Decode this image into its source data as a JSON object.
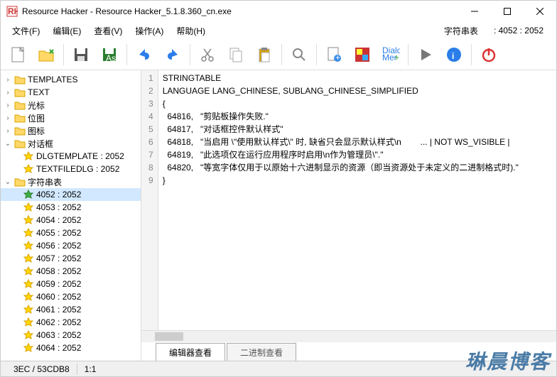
{
  "window": {
    "title": "Resource Hacker - Resource Hacker_5.1.8.360_cn.exe"
  },
  "menu": {
    "file": "文件(F)",
    "edit": "编辑(E)",
    "view": "查看(V)",
    "action": "操作(A)",
    "help": "帮助(H)",
    "charset_label": "字符串表",
    "charset_value": ": 4052 : 2052"
  },
  "tree": {
    "templates": "TEMPLATES",
    "text": "TEXT",
    "cursor": "光标",
    "bitmap": "位图",
    "icon": "图标",
    "dialog": "对话框",
    "dlg1": "DLGTEMPLATE : 2052",
    "dlg2": "TEXTFILEDLG : 2052",
    "strtable": "字符串表",
    "items": [
      "4052 : 2052",
      "4053 : 2052",
      "4054 : 2052",
      "4055 : 2052",
      "4056 : 2052",
      "4057 : 2052",
      "4058 : 2052",
      "4059 : 2052",
      "4060 : 2052",
      "4061 : 2052",
      "4062 : 2052",
      "4063 : 2052",
      "4064 : 2052"
    ]
  },
  "code": {
    "lines": [
      "STRINGTABLE",
      "LANGUAGE LANG_CHINESE, SUBLANG_CHINESE_SIMPLIFIED",
      "{",
      "  64816, \t\"剪贴板操作失败.\"",
      "  64817, \t\"对话框控件默认样式\"",
      "  64818, \t\"当启用 \\\"使用默认样式\\\" 时, 缺省只会显示默认样式\\n        ... | NOT WS_VISIBLE | ",
      "  64819, \t\"此选项仅在运行应用程序时启用\\n作为管理员\\\".\"",
      "  64820, \t\"等宽字体仅用于以原始十六进制显示的资源（即当资源处于未定义的二进制格式时).\"",
      "}"
    ]
  },
  "tabs": {
    "editor": "编辑器查看",
    "binary": "二进制查看"
  },
  "status": {
    "left": "3EC / 53CDB8",
    "pos": "1:1"
  },
  "watermark": "琳晨博客"
}
